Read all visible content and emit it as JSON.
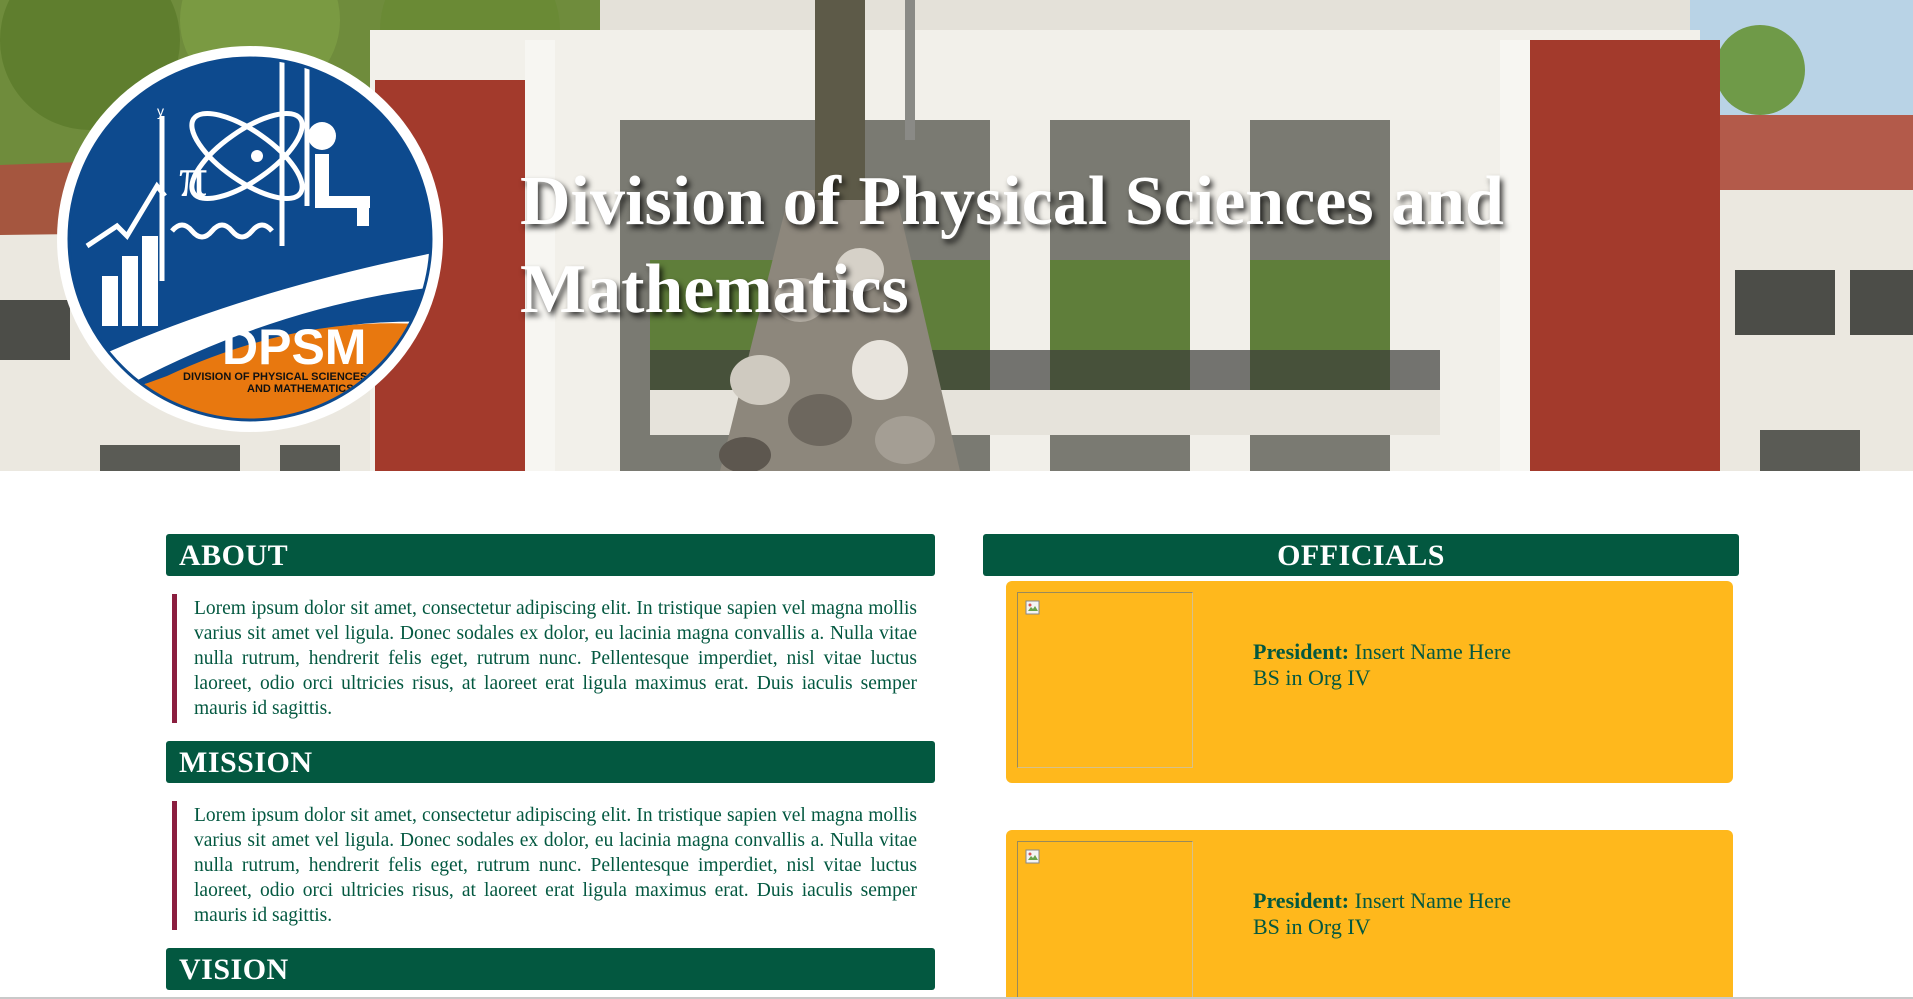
{
  "hero": {
    "title": "Division of Physical Sciences and Mathematics",
    "logo": {
      "acronym": "DPSM",
      "caption_line1": "DIVISION OF PHYSICAL SCIENCES",
      "caption_line2": "AND MATHEMATICS",
      "axis_label": "y",
      "symbol": "π"
    }
  },
  "sections": {
    "about": {
      "title": "ABOUT",
      "body": "Lorem ipsum dolor sit amet, consectetur adipiscing elit. In tristique sapien vel magna mollis varius sit amet vel ligula. Donec sodales ex dolor, eu lacinia magna convallis a. Nulla vitae nulla rutrum, hendrerit felis eget, rutrum nunc. Pellentesque imperdiet, nisl vitae luctus laoreet, odio orci ultricies risus, at laoreet erat ligula maximus erat. Duis iaculis semper mauris id sagittis."
    },
    "mission": {
      "title": "MISSION",
      "body": "Lorem ipsum dolor sit amet, consectetur adipiscing elit. In tristique sapien vel magna mollis varius sit amet vel ligula. Donec sodales ex dolor, eu lacinia magna convallis a. Nulla vitae nulla rutrum, hendrerit felis eget, rutrum nunc. Pellentesque imperdiet, nisl vitae luctus laoreet, odio orci ultricies risus, at laoreet erat ligula maximus erat. Duis iaculis semper mauris id sagittis."
    },
    "vision": {
      "title": "VISION"
    }
  },
  "officials": {
    "title": "OFFICIALS",
    "cards": [
      {
        "role": "President:",
        "name": "Insert Name Here",
        "program": "BS in Org IV"
      },
      {
        "role": "President:",
        "name": "Insert Name Here",
        "program": "BS in Org IV"
      }
    ]
  },
  "colors": {
    "header_green": "#035840",
    "card_gold": "#ffb81c",
    "accent_maroon": "#8b1e3f",
    "logo_blue": "#0d4a8e",
    "logo_orange": "#e8780f"
  }
}
